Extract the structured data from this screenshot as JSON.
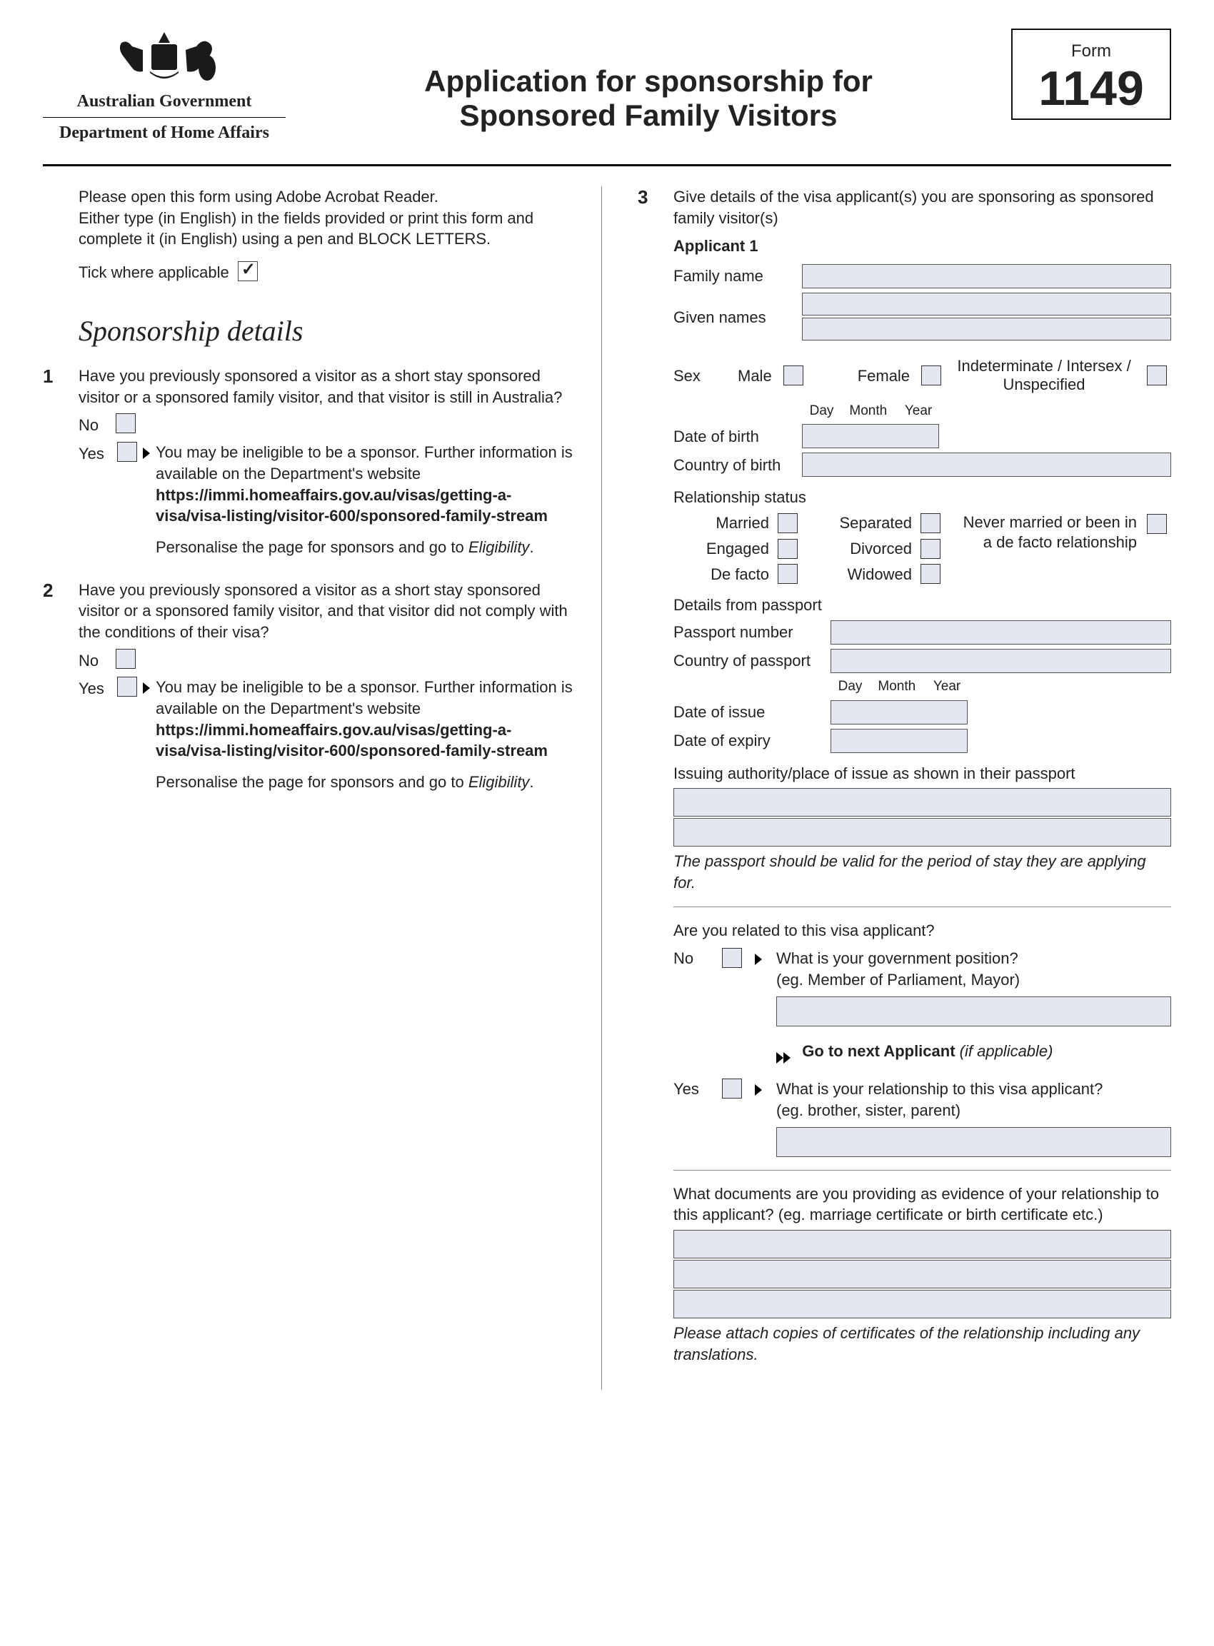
{
  "header": {
    "gov": "Australian Government",
    "dept": "Department of Home Affairs",
    "title1": "Application for sponsorship for",
    "title2": "Sponsored Family Visitors",
    "form_word": "Form",
    "form_num": "1149"
  },
  "intro": {
    "line1": "Please open this form using Adobe Acrobat Reader.",
    "line2": "Either type (in English) in the fields provided or print this form and complete it (in English) using a pen and BLOCK LETTERS.",
    "tick": "Tick where applicable"
  },
  "section_h": "Sponsorship details",
  "q1": {
    "num": "1",
    "text": "Have you previously sponsored a visitor as a short stay sponsored visitor or a sponsored family visitor, and that visitor is still in Australia?",
    "no": "No",
    "yes": "Yes",
    "yes_detail1": "You may be ineligible to be a sponsor. Further information is available on the Department's website",
    "yes_link": "https://immi.homeaffairs.gov.au/visas/getting-a-visa/visa-listing/visitor-600/sponsored-family-stream",
    "yes_detail2a": "Personalise the page for sponsors and go to ",
    "yes_detail2b": "Eligibility",
    "yes_detail2c": "."
  },
  "q2": {
    "num": "2",
    "text": "Have you previously sponsored a visitor as a short stay sponsored visitor or a sponsored family visitor, and that visitor did not comply with the conditions of their visa?",
    "no": "No",
    "yes": "Yes",
    "yes_detail1": "You may be ineligible to be a sponsor. Further information is available on the Department's website",
    "yes_link": "https://immi.homeaffairs.gov.au/visas/getting-a-visa/visa-listing/visitor-600/sponsored-family-stream",
    "yes_detail2a": "Personalise the page for sponsors and go to ",
    "yes_detail2b": "Eligibility",
    "yes_detail2c": "."
  },
  "q3": {
    "num": "3",
    "text": "Give details of the visa applicant(s) you are sponsoring as sponsored family visitor(s)",
    "applicant_h": "Applicant 1",
    "family_name": "Family name",
    "given_names": "Given names",
    "sex": "Sex",
    "male": "Male",
    "female": "Female",
    "inter": "Indeterminate / Intersex / Unspecified",
    "day": "Day",
    "month": "Month",
    "year": "Year",
    "dob": "Date of birth",
    "cob": "Country of birth",
    "rel_status": "Relationship status",
    "married": "Married",
    "engaged": "Engaged",
    "defacto": "De facto",
    "separated": "Separated",
    "divorced": "Divorced",
    "widowed": "Widowed",
    "never": "Never married or been in a de facto relationship",
    "passport_h": "Details from passport",
    "passport_num": "Passport number",
    "cop": "Country of passport",
    "doi": "Date of issue",
    "doe": "Date of expiry",
    "issue_auth": "Issuing authority/place of issue as shown in their passport",
    "passport_note": "The passport should be valid for the period of stay they are applying for.",
    "related_q": "Are you related to this visa applicant?",
    "no": "No",
    "no_q": "What is your government position?",
    "no_eg": "(eg. Member of Parliament, Mayor)",
    "go_next": "Go to next Applicant ",
    "go_next_if": "(if applicable)",
    "yes": "Yes",
    "yes_q": "What is your relationship to this visa applicant?",
    "yes_eg": "(eg. brother, sister, parent)",
    "docs_q": "What documents are you providing as evidence of your relationship to this applicant? (eg. marriage certificate or birth certificate etc.)",
    "docs_note": "Please attach copies of certificates of the relationship including any translations."
  }
}
